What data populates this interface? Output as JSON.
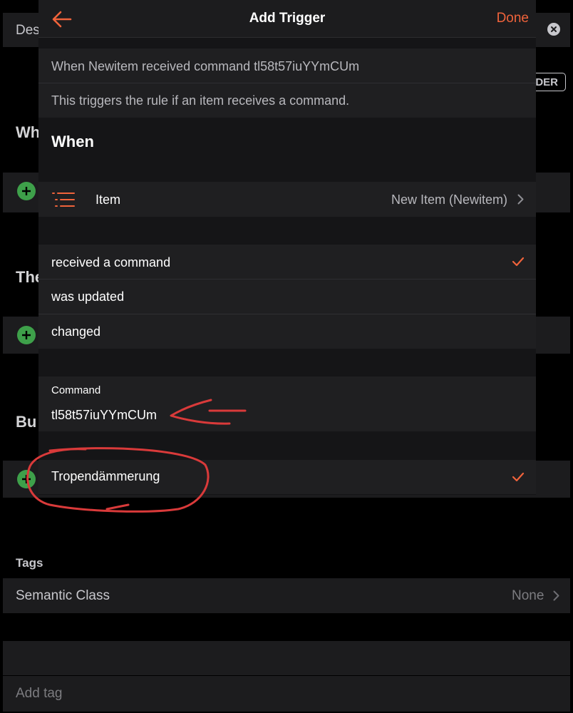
{
  "background": {
    "description_label": "Des",
    "order_badge": "DER",
    "when_heading": "Wh",
    "then_heading": "The",
    "but_heading": "Bu",
    "tags_heading": "Tags",
    "semantic_class_label": "Semantic Class",
    "semantic_class_value": "None",
    "add_tag_placeholder": "Add tag"
  },
  "modal": {
    "title": "Add Trigger",
    "done_label": "Done",
    "summary": "When Newitem received command tl58t57iuYYmCUm",
    "description": "This triggers the rule if an item receives a command.",
    "section_title": "When",
    "item_row": {
      "label": "Item",
      "value": "New Item (Newitem)"
    },
    "event_options": [
      {
        "label": "received a command",
        "selected": true
      },
      {
        "label": "was updated",
        "selected": false
      },
      {
        "label": "changed",
        "selected": false
      }
    ],
    "command": {
      "label": "Command",
      "value": "tl58t57iuYYmCUm"
    },
    "option_row": {
      "label": "Tropendämmerung",
      "selected": true
    }
  },
  "colors": {
    "accent": "#f0633b",
    "add_green": "#3ea04a",
    "annotation_red": "#d93a3a"
  }
}
